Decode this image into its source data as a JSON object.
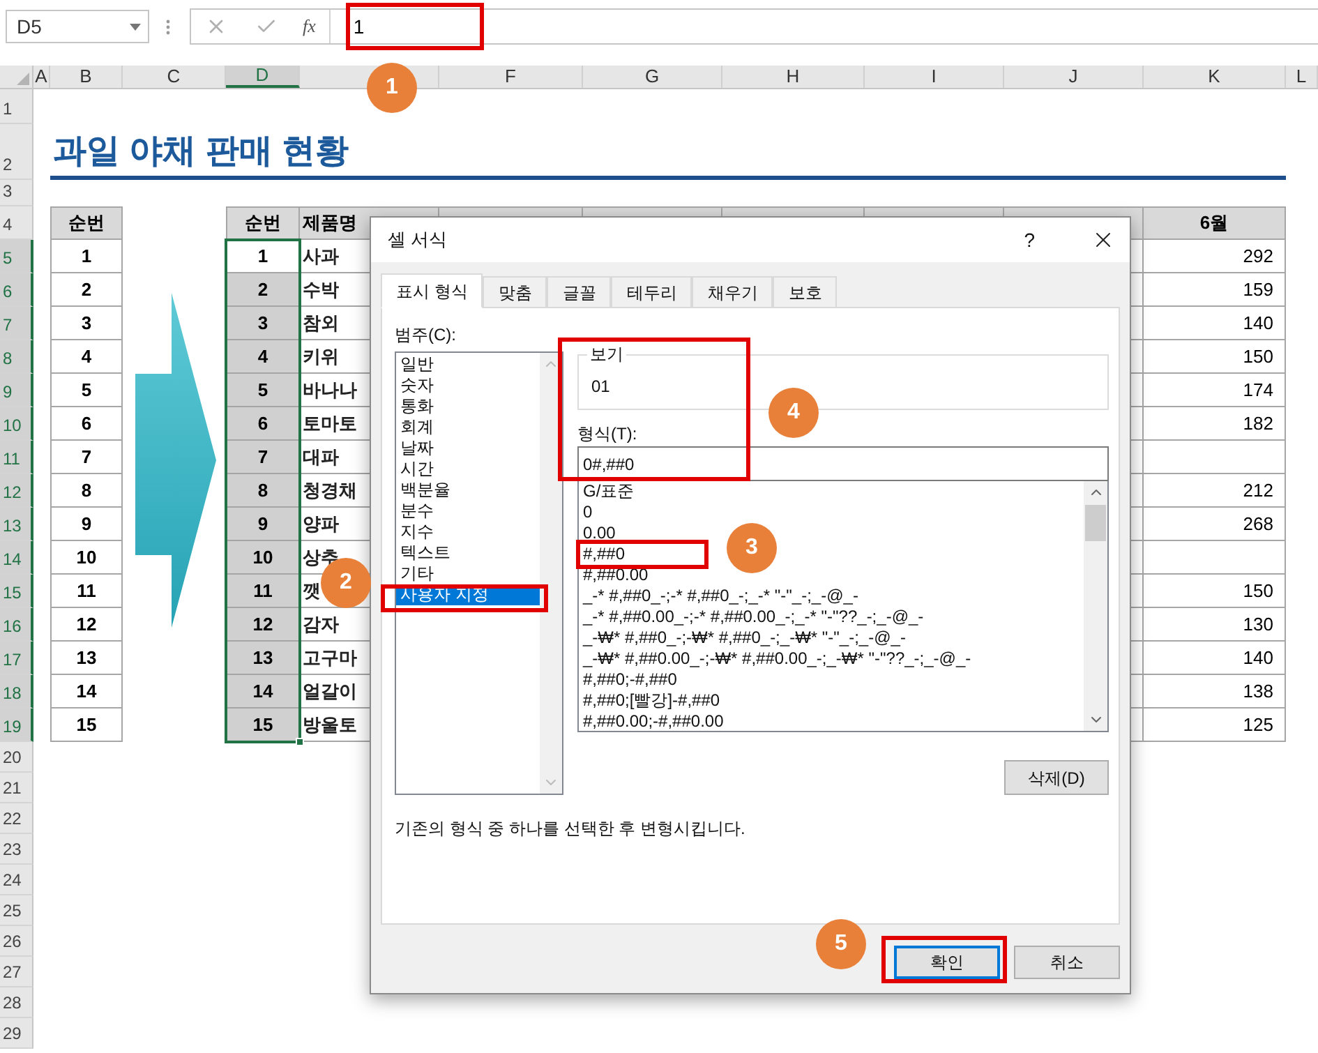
{
  "formula_bar": {
    "name_box": "D5",
    "function_button": "fx",
    "formula": "1"
  },
  "columns": [
    {
      "label": "A",
      "selected": false
    },
    {
      "label": "B",
      "selected": false
    },
    {
      "label": "C",
      "selected": false
    },
    {
      "label": "D",
      "selected": true
    },
    {},
    {
      "label": "F",
      "selected": false
    },
    {
      "label": "G",
      "selected": false
    },
    {
      "label": "H",
      "selected": false
    },
    {
      "label": "I",
      "selected": false
    },
    {
      "label": "J",
      "selected": false
    },
    {
      "label": "K",
      "selected": false
    },
    {
      "label": "L",
      "selected": false
    }
  ],
  "rows": [
    {
      "label": "1",
      "selected": false
    },
    {
      "label": "2",
      "selected": false
    },
    {
      "label": "3",
      "selected": false
    },
    {
      "label": "4",
      "selected": false
    },
    {
      "label": "5",
      "selected": true
    },
    {
      "label": "6",
      "selected": true
    },
    {
      "label": "7",
      "selected": true
    },
    {
      "label": "8",
      "selected": true
    },
    {
      "label": "9",
      "selected": true
    },
    {
      "label": "10",
      "selected": true
    },
    {
      "label": "11",
      "selected": true
    },
    {
      "label": "12",
      "selected": true
    },
    {
      "label": "13",
      "selected": true
    },
    {
      "label": "14",
      "selected": true
    },
    {
      "label": "15",
      "selected": true
    },
    {
      "label": "16",
      "selected": true
    },
    {
      "label": "17",
      "selected": true
    },
    {
      "label": "18",
      "selected": true
    },
    {
      "label": "19",
      "selected": true
    },
    {
      "label": "20",
      "selected": false
    },
    {
      "label": "21",
      "selected": false
    },
    {
      "label": "22",
      "selected": false
    },
    {
      "label": "23",
      "selected": false
    },
    {
      "label": "24",
      "selected": false
    },
    {
      "label": "25",
      "selected": false
    },
    {
      "label": "26",
      "selected": false
    },
    {
      "label": "27",
      "selected": false
    },
    {
      "label": "28",
      "selected": false
    },
    {
      "label": "29",
      "selected": false
    }
  ],
  "sheet": {
    "title": "과일 야채 판매 현황",
    "left_table": {
      "header": "순번",
      "values": [
        "1",
        "2",
        "3",
        "4",
        "5",
        "6",
        "7",
        "8",
        "9",
        "10",
        "11",
        "12",
        "13",
        "14",
        "15"
      ]
    },
    "main_table": {
      "headers": {
        "d": "순번",
        "e": "제품명",
        "k": "6월"
      },
      "rows": [
        {
          "d": "1",
          "active": true,
          "e": "사과",
          "k": "292"
        },
        {
          "d": "2",
          "active": false,
          "e": "수박",
          "k": "159"
        },
        {
          "d": "3",
          "active": false,
          "e": "참외",
          "k": "140"
        },
        {
          "d": "4",
          "active": false,
          "e": "키위",
          "k": "150"
        },
        {
          "d": "5",
          "active": false,
          "e": "바나나",
          "k": "174"
        },
        {
          "d": "6",
          "active": false,
          "e": "토마토",
          "k": "182"
        },
        {
          "d": "7",
          "active": false,
          "e": "대파"
        },
        {
          "d": "8",
          "active": false,
          "e": "청경채",
          "k": "212"
        },
        {
          "d": "9",
          "active": false,
          "e": "양파",
          "k": "268"
        },
        {
          "d": "10",
          "active": false,
          "e": "상추"
        },
        {
          "d": "11",
          "active": false,
          "e": "깻",
          "k": "150"
        },
        {
          "d": "12",
          "active": false,
          "e": "감자",
          "k": "130"
        },
        {
          "d": "13",
          "active": false,
          "e": "고구마",
          "k": "140"
        },
        {
          "d": "14",
          "active": false,
          "e": "얼갈이",
          "k": "138"
        },
        {
          "d": "15",
          "active": false,
          "e": "방울토",
          "k": "125"
        }
      ]
    }
  },
  "dialog": {
    "title": "셀 서식",
    "help": "?",
    "tabs": [
      {
        "label": "표시 형식",
        "selected": true
      },
      {
        "label": "맞춤",
        "selected": false
      },
      {
        "label": "글꼴",
        "selected": false
      },
      {
        "label": "테두리",
        "selected": false
      },
      {
        "label": "채우기",
        "selected": false
      },
      {
        "label": "보호",
        "selected": false
      }
    ],
    "category_label": "범주(C):",
    "categories": [
      {
        "label": "일반",
        "selected": false
      },
      {
        "label": "숫자",
        "selected": false
      },
      {
        "label": "통화",
        "selected": false
      },
      {
        "label": "회계",
        "selected": false
      },
      {
        "label": "날짜",
        "selected": false
      },
      {
        "label": "시간",
        "selected": false
      },
      {
        "label": "백분율",
        "selected": false
      },
      {
        "label": "분수",
        "selected": false
      },
      {
        "label": "지수",
        "selected": false
      },
      {
        "label": "텍스트",
        "selected": false
      },
      {
        "label": "기타",
        "selected": false
      },
      {
        "label": "사용자 지정",
        "selected": true
      }
    ],
    "sample_legend": "보기",
    "sample_value": "01",
    "format_label": "형식(T):",
    "format_value": "0#,##0",
    "formats": [
      "G/표준",
      "0",
      "0.00",
      "#,##0",
      "#,##0.00",
      "_-* #,##0_-;-* #,##0_-;_-* \"-\"_-;_-@_-",
      "_-* #,##0.00_-;-* #,##0.00_-;_-* \"-\"??_-;_-@_-",
      "_-₩* #,##0_-;-₩* #,##0_-;_-₩* \"-\"_-;_-@_-",
      "_-₩* #,##0.00_-;-₩* #,##0.00_-;_-₩* \"-\"??_-;_-@_-",
      "#,##0;-#,##0",
      "#,##0;[빨강]-#,##0",
      "#,##0.00;-#,##0.00"
    ],
    "delete_button": "삭제(D)",
    "description": "기존의 형식 중 하나를 선택한 후 변형시킵니다.",
    "buttons": [
      {
        "label": "확인",
        "default": true
      },
      {
        "label": "취소",
        "default": false
      }
    ]
  },
  "callouts": [
    {
      "label": "1"
    },
    {
      "label": "2"
    },
    {
      "label": "3"
    },
    {
      "label": "4"
    },
    {
      "label": "5"
    }
  ]
}
